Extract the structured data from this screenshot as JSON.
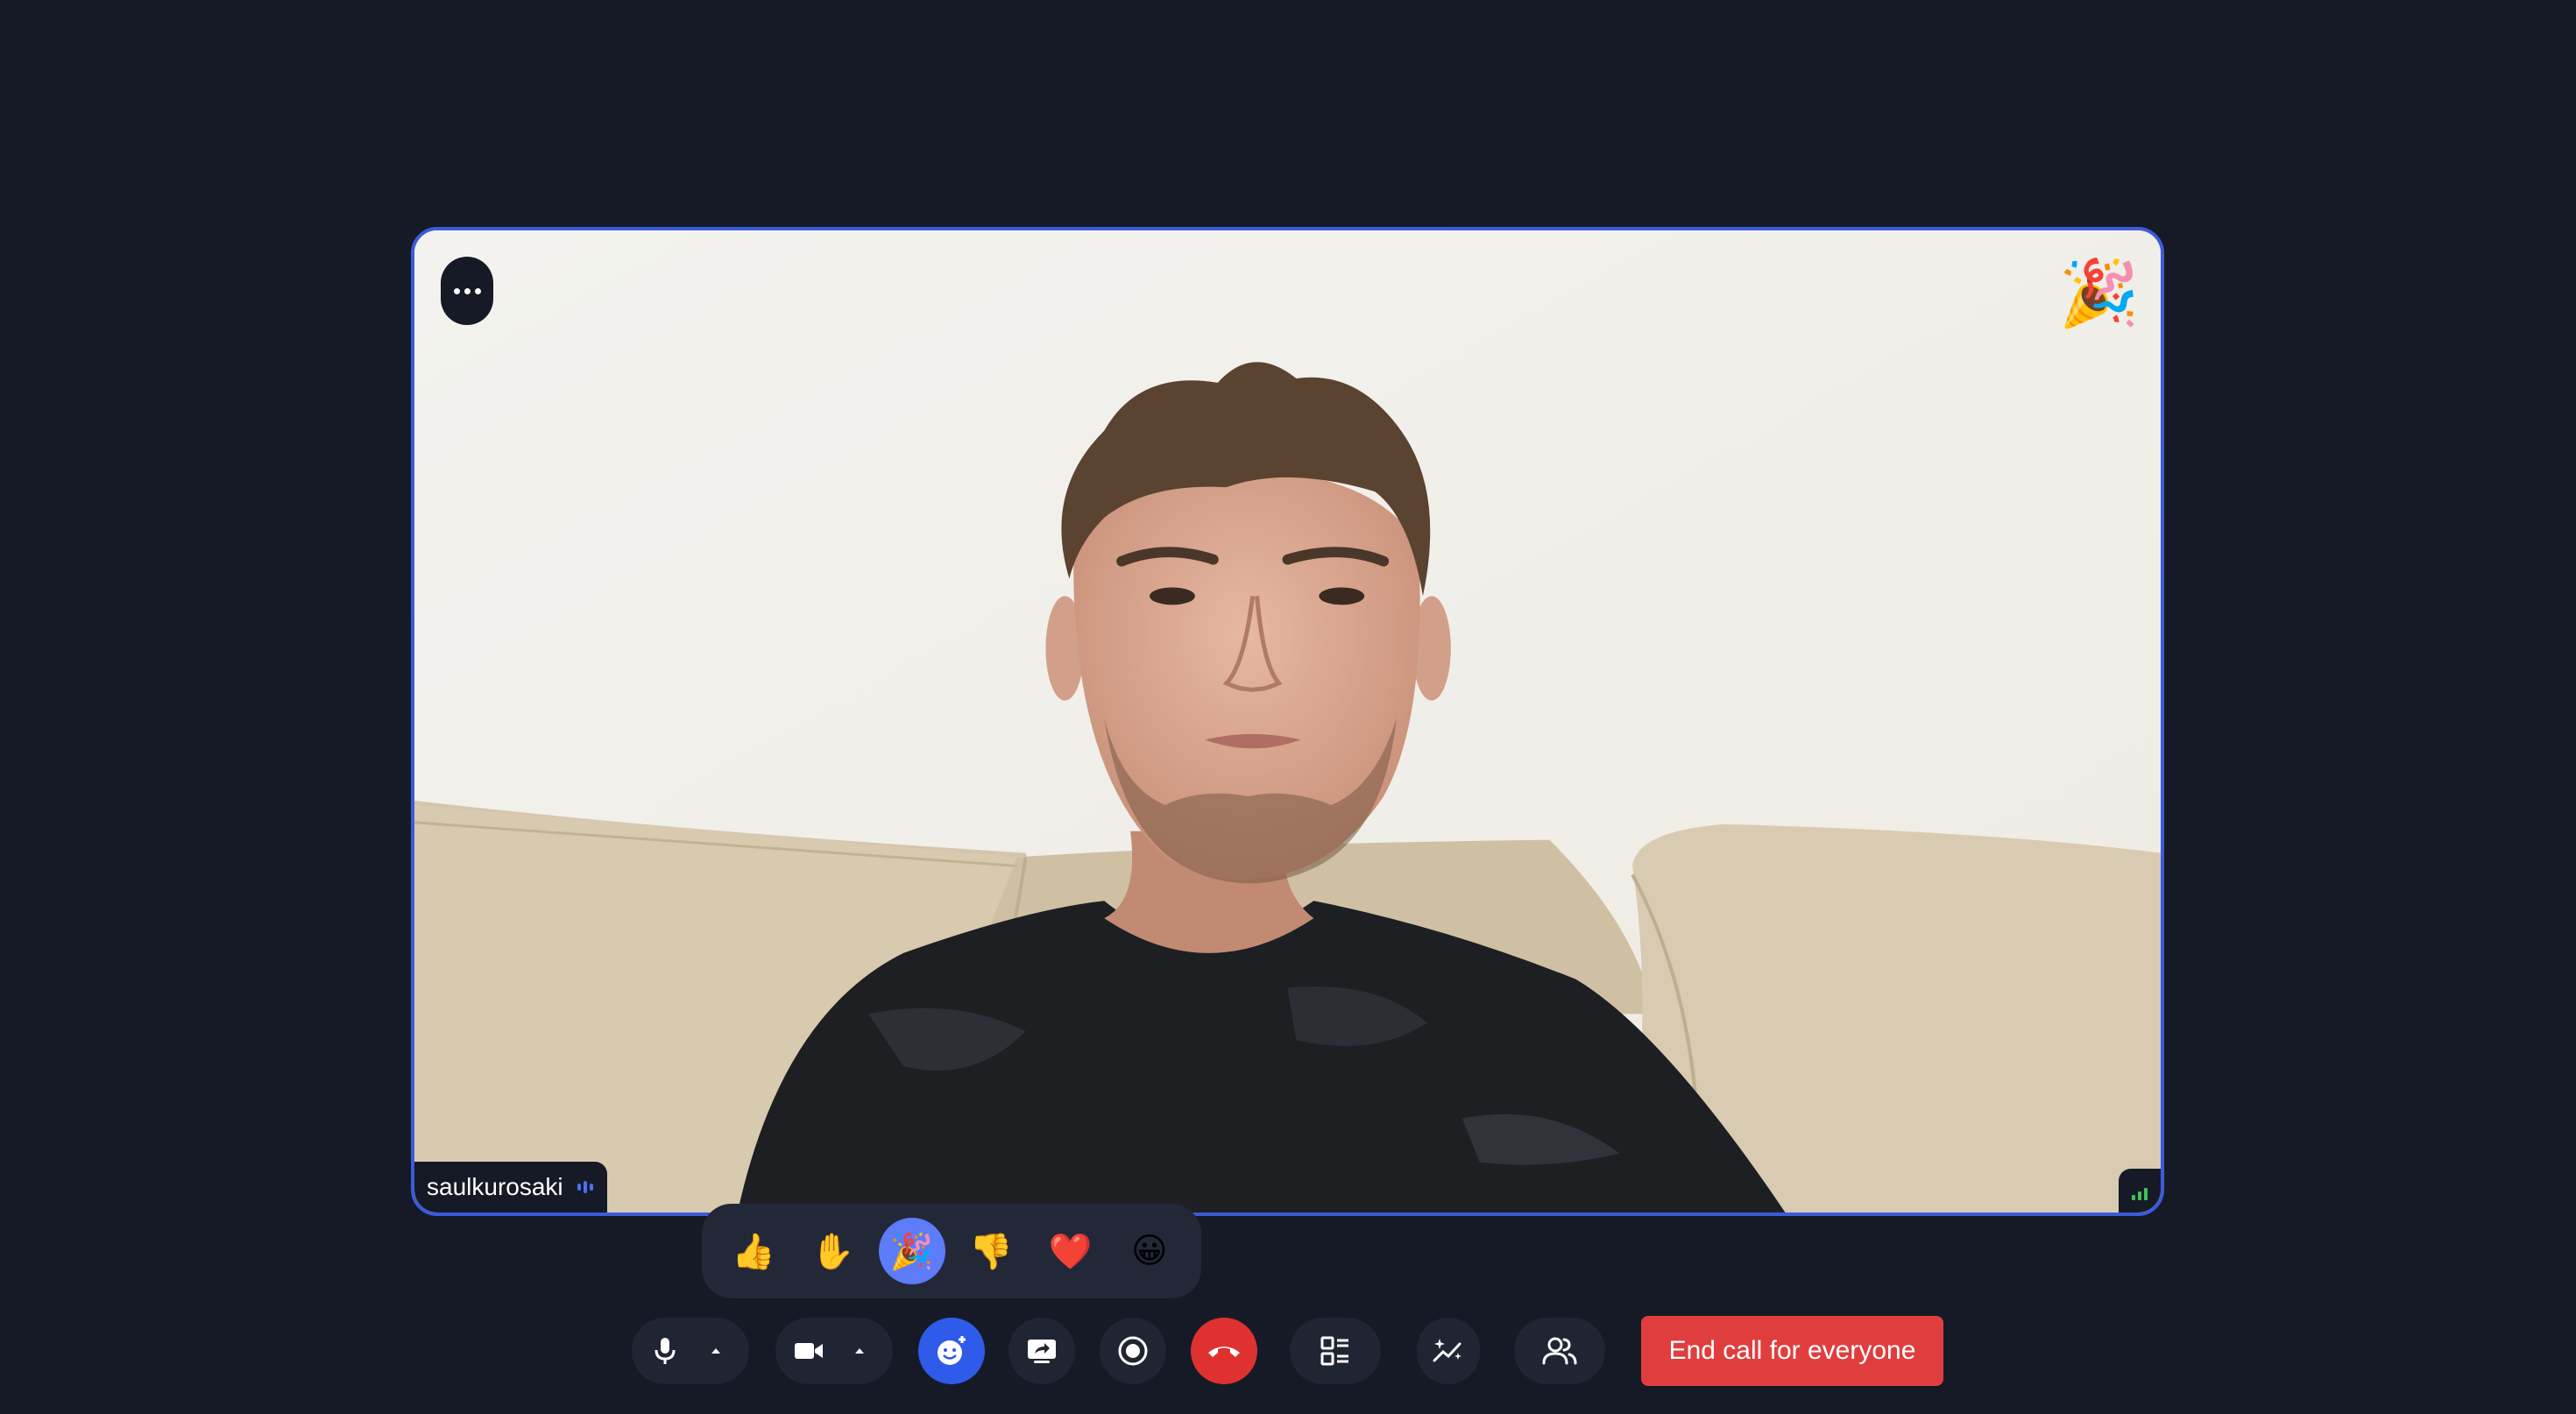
{
  "participant": {
    "name": "saulkurosaki",
    "reaction_emoji": "🎉"
  },
  "reactions": [
    {
      "emoji": "👍",
      "icon": "thumbs-up",
      "active": false
    },
    {
      "emoji": "✋",
      "icon": "raised-hand",
      "active": false
    },
    {
      "emoji": "🎉",
      "icon": "party-popper",
      "active": true
    },
    {
      "emoji": "👎",
      "icon": "thumbs-down",
      "active": false
    },
    {
      "emoji": "❤️",
      "icon": "heart",
      "active": false
    },
    {
      "emoji": "😀",
      "icon": "grinning-face",
      "active": false
    }
  ],
  "toolbar": {
    "end_call_everyone_label": "End call for everyone"
  },
  "colors": {
    "background": "#161a26",
    "active_border": "#3b5bdb",
    "accent_blue": "#2f5bea",
    "danger_red": "#e03e3e"
  }
}
